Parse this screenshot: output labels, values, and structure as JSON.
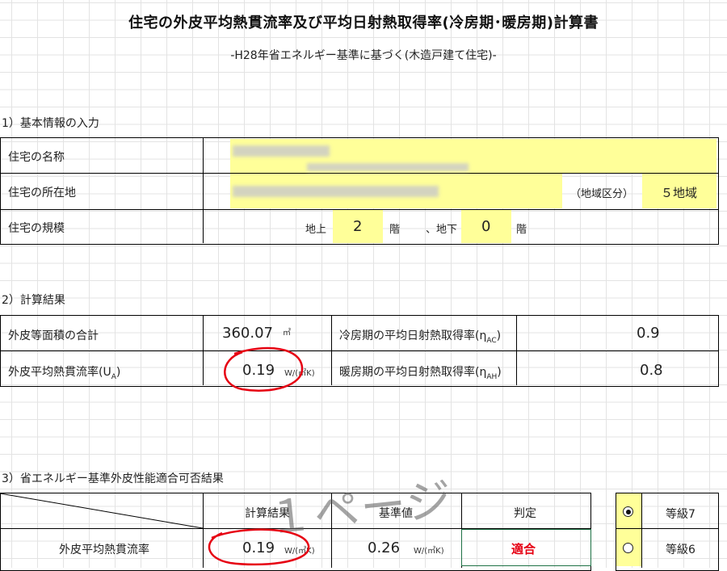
{
  "header": {
    "title": "住宅の外皮平均熱貫流率及び平均日射熱取得率(冷房期･暖房期)計算書",
    "subtitle": "-H28年省エネルギー基準に基づく(木造戸建て住宅)-"
  },
  "section1": {
    "heading": "1）基本情報の入力",
    "name_label": "住宅の名称",
    "address_label": "住宅の所在地",
    "region_label": "（地域区分）",
    "region_value": "５地域",
    "scale_label": "住宅の規模",
    "above_label": "地上",
    "above_value": "2",
    "floor_unit1": "階",
    "below_label": "、地下",
    "below_value": "0",
    "floor_unit2": "階"
  },
  "section2": {
    "heading": "2）計算結果",
    "area_label": "外皮等面積の合計",
    "area_value": "360.07",
    "area_unit": "㎡",
    "ua_label": "外皮平均熱貫流率(U",
    "ua_sub": "A",
    "ua_close": ")",
    "ua_value": "0.19",
    "ua_unit": "W/(㎡K)",
    "eta_ac_label": "冷房期の平均日射熱取得率(η",
    "eta_ac_sub": "AC",
    "eta_ac_close": ")",
    "eta_ac_value": "0.9",
    "eta_ah_label": "暖房期の平均日射熱取得率(η",
    "eta_ah_sub": "AH",
    "eta_ah_close": ")",
    "eta_ah_value": "0.8"
  },
  "section3": {
    "heading": "3）省エネルギー基準外皮性能適合可否結果",
    "col_calc": "計算結果",
    "col_std": "基準値",
    "col_judge": "判定",
    "row_label": "外皮平均熱貫流率",
    "calc_value": "0.19",
    "calc_unit": "W/(㎡K)",
    "std_value": "0.26",
    "std_unit": "W/(㎡K)",
    "judge_value": "適合",
    "grade7": "等級7",
    "grade6": "等級6",
    "grade_selected": "等級7"
  },
  "watermark": "１ページ",
  "colors": {
    "input_fill": "#ffff99",
    "red_mark": "#e60012",
    "selection": "#1e7145"
  }
}
